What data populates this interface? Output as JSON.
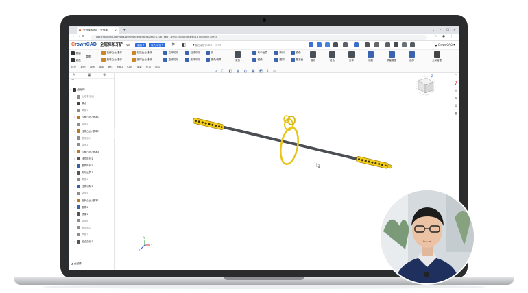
{
  "browser": {
    "tab_title": "全冠棒和牙铲 - 全冠棒",
    "tab_close": "×",
    "new_tab": "+",
    "url": "cad.crowncad.com/cad/workspace/p/docId&ws=1378 (a657-89f1/3d/docId&ws=1378 (a657-89f5)",
    "window_controls": [
      "⌄",
      "–",
      "☐",
      "×"
    ]
  },
  "app": {
    "brand": "CrownCAD",
    "doc_title": "全冠棒和牙铲",
    "new_button": "新建 ▾",
    "import_button": "导入/导出 ▾",
    "autosave": "最近保存于08:27 14:01",
    "brand_right": "CrownCAD"
  },
  "ribbon": {
    "left_undo": "撤销",
    "left_redo": "重做",
    "sketch_group": "草图",
    "row1": [
      "拉伸凸台/基体",
      "扫描凸台/基体",
      "拉伸切除",
      "扫描切除",
      "孔"
    ],
    "row2": [
      "旋转凸台/基体",
      "放样凸台/基体",
      "旋转切除",
      "放样切除",
      "圆角/倒角"
    ],
    "row3": [
      "倒角",
      "圆角",
      "拔模",
      "抽壳",
      "筋"
    ],
    "group_right": [
      "布尔运算",
      "阵列",
      "镜像",
      "镜像",
      "圆周",
      "基准面",
      "曲线",
      "组合",
      "实体",
      "其他"
    ],
    "large_buttons": [
      "变换",
      "阵列",
      "布尔运算",
      "测量",
      "质量属性",
      "选择",
      "全局管理"
    ],
    "menu_tabs": [
      "特征",
      "草图",
      "曲面",
      "钣金",
      "焊件",
      "MBD",
      "CAM",
      "渲染",
      "仿真",
      "插件"
    ]
  },
  "sidebar": {
    "tabs": [
      "✎",
      "▣",
      "⚙"
    ],
    "filter_icon": "⊤",
    "tree": [
      {
        "label": "全冠棒",
        "grey": false,
        "color": "#333333"
      },
      {
        "label": "上视基准面",
        "grey": true,
        "color": "#8d8d8d"
      },
      {
        "label": "原点",
        "grey": false,
        "color": "#444444"
      },
      {
        "label": "草图1",
        "grey": true,
        "color": "#8d8d8d"
      },
      {
        "label": "拉伸凸台/基体1",
        "grey": false,
        "color": "#b47b2a"
      },
      {
        "label": "草图2",
        "grey": true,
        "color": "#8d8d8d"
      },
      {
        "label": "拉伸凸台/基体2",
        "grey": false,
        "color": "#b47b2a"
      },
      {
        "label": "基准面1",
        "grey": true,
        "color": "#8d8d8d"
      },
      {
        "label": "草图3",
        "grey": true,
        "color": "#8d8d8d"
      },
      {
        "label": "拉伸凸台/基体3",
        "grey": false,
        "color": "#b47b2a"
      },
      {
        "label": "线性阵列1",
        "grey": false,
        "color": "#555555"
      },
      {
        "label": "圆周阵列1",
        "grey": false,
        "color": "#3b5fa8"
      },
      {
        "label": "布尔运算1",
        "grey": false,
        "color": "#555555"
      },
      {
        "label": "草图4",
        "grey": true,
        "color": "#8d8d8d"
      },
      {
        "label": "拉伸切除1",
        "grey": false,
        "color": "#3b5fa8"
      },
      {
        "label": "草图5",
        "grey": true,
        "color": "#8d8d8d"
      },
      {
        "label": "旋转凸台/基体1",
        "grey": false,
        "color": "#b47b2a"
      },
      {
        "label": "圆角1",
        "grey": false,
        "color": "#3b5fa8"
      },
      {
        "label": "镜像1",
        "grey": false,
        "color": "#555555"
      },
      {
        "label": "草图6",
        "grey": true,
        "color": "#8d8d8d"
      },
      {
        "label": "基准面2",
        "grey": true,
        "color": "#8d8d8d"
      },
      {
        "label": "草图7",
        "grey": true,
        "color": "#8d8d8d"
      },
      {
        "label": "组合曲线1",
        "grey": false,
        "color": "#555555"
      }
    ],
    "footer": "全冠棒",
    "collapse": "‹"
  },
  "viewport": {
    "toolbar_icons": [
      "⌕",
      "⛶",
      "◧",
      "◉",
      "◐",
      "▣",
      "◩",
      "⟟",
      "▭"
    ],
    "right_icons": [
      "▢",
      "❓",
      "◎",
      "✎",
      "▤",
      "▦"
    ],
    "axis_labels": {
      "x": "X",
      "y": "Y",
      "z": "Z"
    },
    "model": {
      "rod_color": "#4a4e52",
      "gold_color": "#f2cc1a",
      "ring_color": "#e8c51c"
    }
  }
}
